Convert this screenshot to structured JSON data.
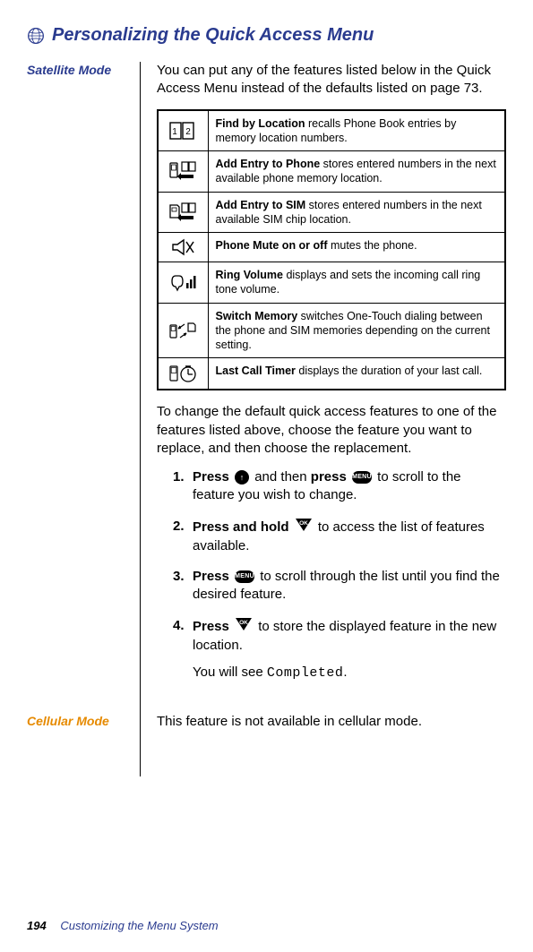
{
  "header": {
    "title": "Personalizing the Quick Access Menu"
  },
  "sidebar": {
    "satellite_label": "Satellite Mode",
    "cellular_label": "Cellular Mode"
  },
  "intro": "You can put any of the features listed below in the Quick Access Menu instead of the defaults listed on page 73.",
  "features": [
    {
      "bold": "Find by Location",
      "rest": " recalls Phone Book entries by memory location numbers."
    },
    {
      "bold": "Add Entry to Phone",
      "rest": " stores entered numbers in the next available phone memory location."
    },
    {
      "bold": "Add Entry to SIM",
      "rest": " stores entered numbers in the next available SIM chip location."
    },
    {
      "bold": "Phone Mute on or off",
      "rest": " mutes the phone."
    },
    {
      "bold": "Ring Volume",
      "rest": " displays and sets the incoming call ring tone volume."
    },
    {
      "bold": "Switch Memory",
      "rest": " switches One-Touch dialing between the phone and SIM memories depending on the current setting."
    },
    {
      "bold": "Last Call Timer",
      "rest": " displays the duration of your last call."
    }
  ],
  "mid_para": "To change the default quick access features to one of the features listed above, choose the feature you want to replace, and then choose the replacement.",
  "steps": {
    "s1": {
      "lead": "Press",
      "mid": " and then ",
      "press2": "press",
      "tail": " to scroll to the feature you wish to change."
    },
    "s2": {
      "lead": "Press and hold",
      "tail": " to access the list of features available."
    },
    "s3": {
      "lead": "Press",
      "tail": " to scroll through the list until you find the desired feature."
    },
    "s4": {
      "lead": "Press",
      "tail": " to store the displayed feature in the new location.",
      "sub_pre": "You will see ",
      "sub_code": "Completed",
      "sub_post": "."
    }
  },
  "buttons": {
    "menu": "MENU",
    "ok": "OK",
    "up": "↑"
  },
  "cellular_text": "This feature is not available in cellular mode.",
  "footer": {
    "page": "194",
    "section": "Customizing the Menu System"
  }
}
